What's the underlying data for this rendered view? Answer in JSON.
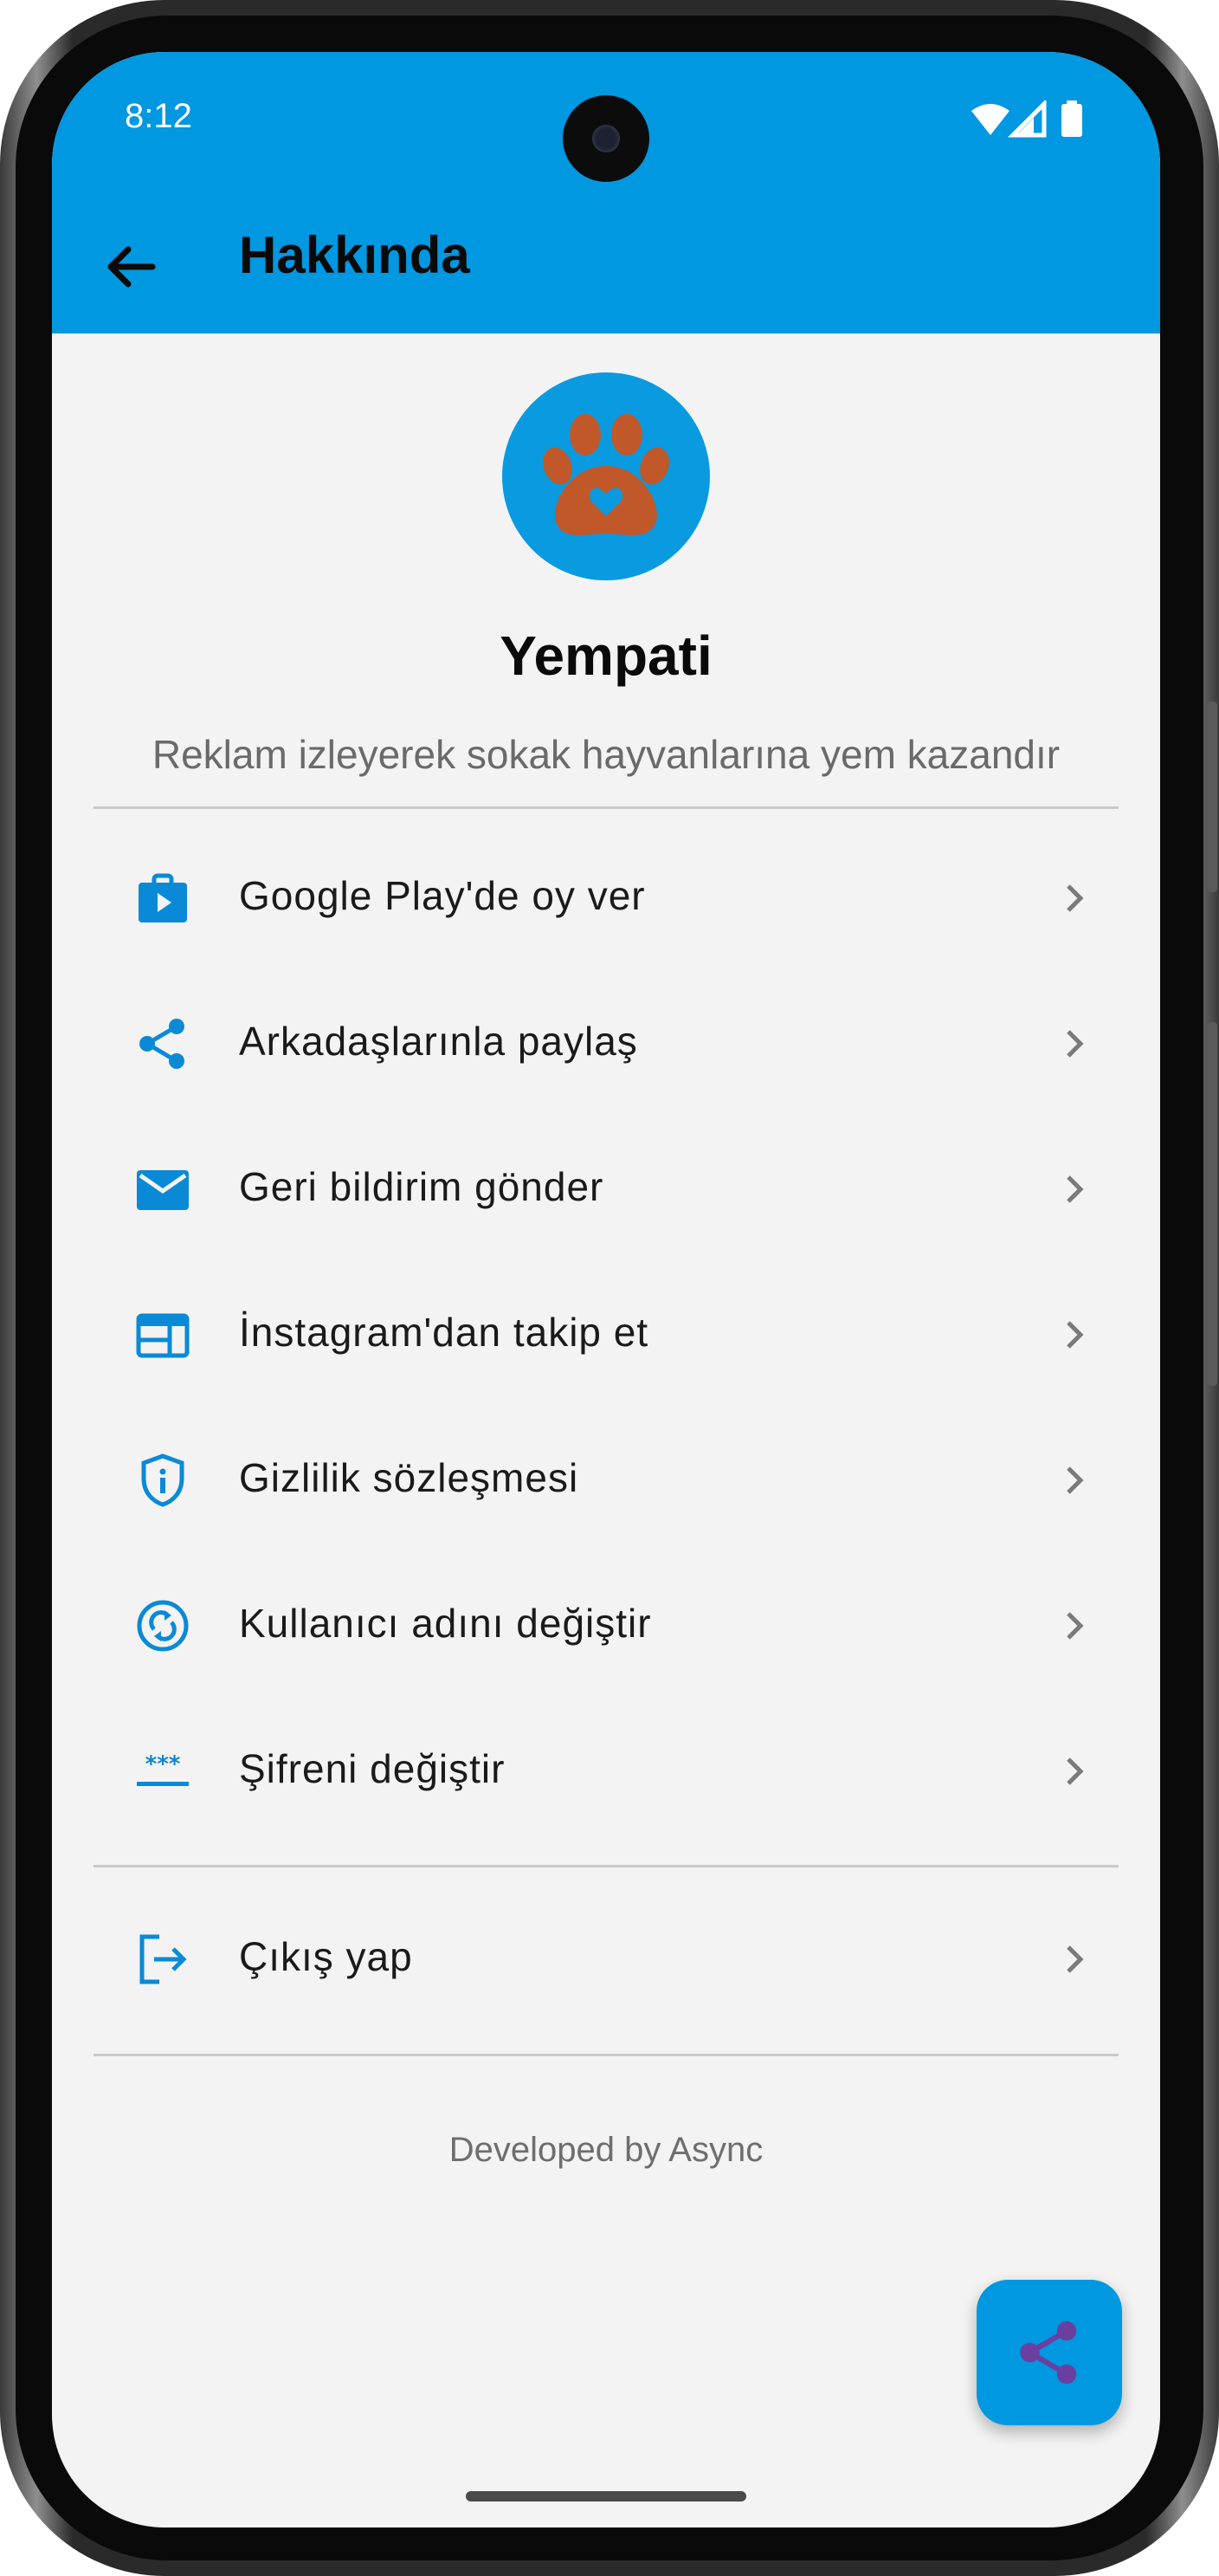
{
  "status_bar": {
    "time": "8:12"
  },
  "app_bar": {
    "title": "Hakkında"
  },
  "profile": {
    "app_name": "Yempati",
    "tagline": "Reklam izleyerek sokak hayvanlarına yem kazandır"
  },
  "menu": [
    {
      "icon": "google-play-icon",
      "label": "Google Play'de oy ver"
    },
    {
      "icon": "share-icon",
      "label": "Arkadaşlarınla paylaş"
    },
    {
      "icon": "mail-icon",
      "label": "Geri bildirim gönder"
    },
    {
      "icon": "web-icon",
      "label": "İnstagram'dan takip et"
    },
    {
      "icon": "privacy-shield-icon",
      "label": "Gizlilik sözleşmesi"
    },
    {
      "icon": "sync-user-icon",
      "label": "Kullanıcı adını değiştir"
    },
    {
      "icon": "password-icon",
      "label": "Şifreni değiştir"
    }
  ],
  "logout": {
    "icon": "logout-icon",
    "label": "Çıkış yap"
  },
  "footer": {
    "text": "Developed by Async"
  },
  "colors": {
    "primary": "#0098e0",
    "icon_accent": "#0a8ad6",
    "paw": "#c0582a",
    "fab_icon": "#6b3fa0",
    "background": "#f3f3f3"
  }
}
